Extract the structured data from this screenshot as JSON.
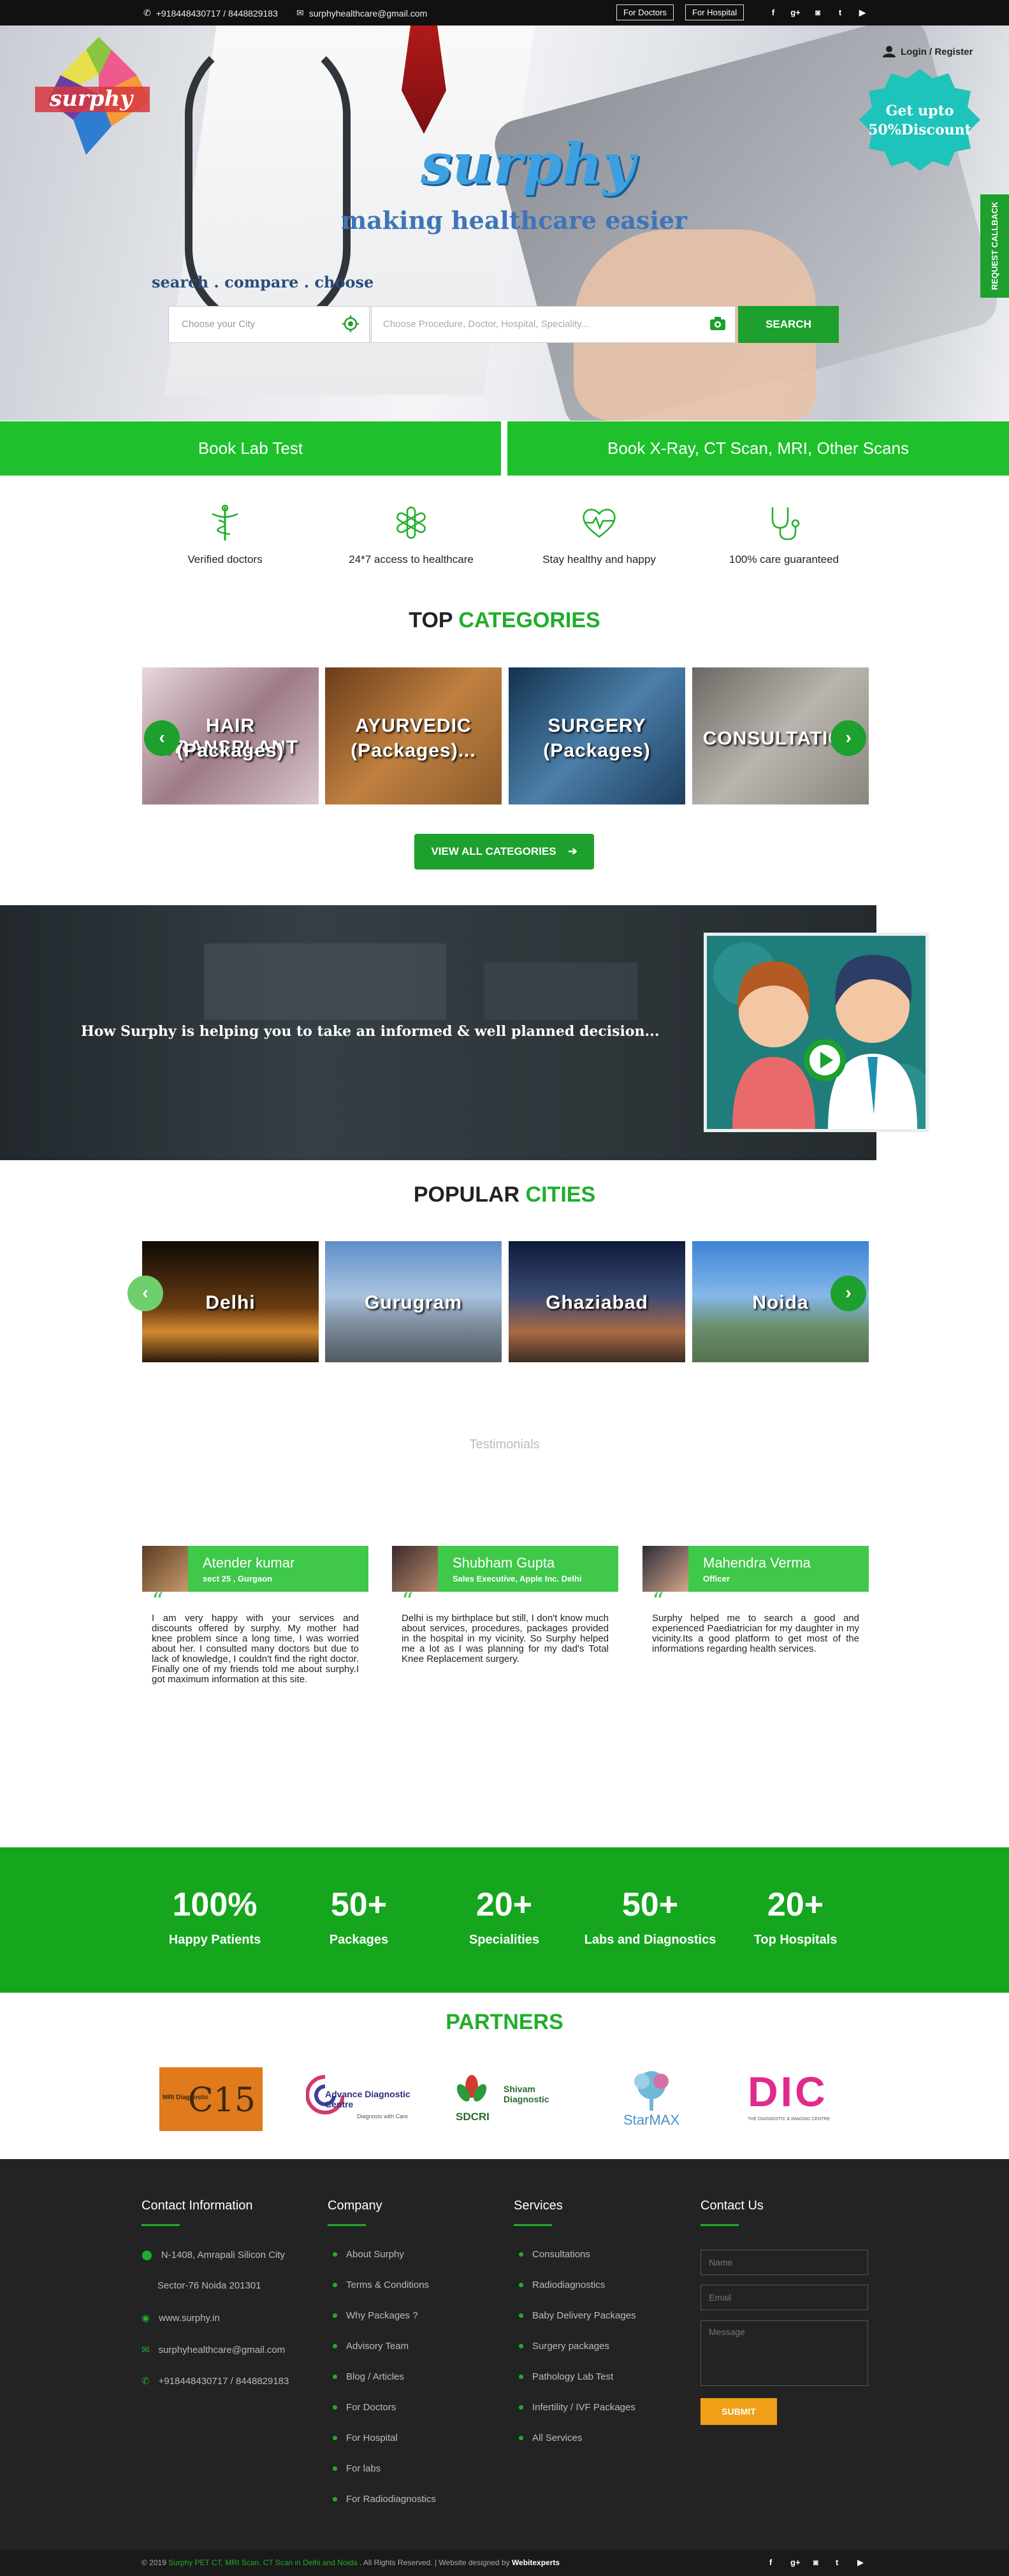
{
  "topbar": {
    "phone": "+918448430717 / 8448829183",
    "email": "surphyhealthcare@gmail.com",
    "btn_doctors": "For Doctors",
    "btn_hospital": "For Hospital",
    "social": [
      "facebook-icon",
      "google-plus-icon",
      "instagram-icon",
      "twitter-icon",
      "youtube-icon"
    ]
  },
  "hero": {
    "logo": "surphy",
    "brand": "surphy",
    "tagline": "making healthcare easier",
    "scc": "search . compare . choose",
    "city_placeholder": "Choose your City",
    "procedure_placeholder": "Choose Procedure, Doctor, Hospital, Speciality...",
    "search_label": "SEARCH",
    "login_label": "Login / Register",
    "badge_line1": "Get upto",
    "badge_line2": "50%Discount",
    "callback_label": "REQUEST CALLBACK"
  },
  "book": {
    "lab": "Book Lab Test",
    "scan": "Book X-Ray, CT Scan, MRI, Other Scans"
  },
  "features": [
    {
      "label": "Verified doctors",
      "icon": "caduceus-icon"
    },
    {
      "label": "24*7 access to healthcare",
      "icon": "medical-cross-icon"
    },
    {
      "label": "Stay healthy and happy",
      "icon": "heartbeat-icon"
    },
    {
      "label": "100% care guaranteed",
      "icon": "stethoscope-icon"
    }
  ],
  "categories": {
    "title_a": "TOP ",
    "title_b": "CATEGORIES",
    "items": [
      {
        "line1": "HAIR TRANSPLANT",
        "line2": "(Packages)"
      },
      {
        "line1": "AYURVEDIC",
        "line2": "(Packages)..."
      },
      {
        "line1": "SURGERY",
        "line2": "(Packages)"
      },
      {
        "line1": "CONSULTATION",
        "line2": ""
      }
    ],
    "view_all": "VIEW ALL CATEGORIES"
  },
  "video": {
    "text": "How Surphy is helping you to take an informed & well planned decision..."
  },
  "cities": {
    "title_a": "POPULAR ",
    "title_b": "CITIES",
    "items": [
      "Delhi",
      "Gurugram",
      "Ghaziabad",
      "Noida"
    ]
  },
  "testimonials": {
    "heading": "Testimonials",
    "items": [
      {
        "name": "Atender kumar",
        "sub": "sect 25 , Gurgaon",
        "text": "I am very happy with your services and discounts offered by surphy. My mother had knee problem since a long time, I was worried about her. I consulted many doctors but due to lack of knowledge, I couldn't find the right doctor. Finally one of my friends told me about surphy.I got maximum information at this site."
      },
      {
        "name": "Shubham Gupta",
        "sub": "Sales Executive, Apple Inc. Delhi",
        "text": "Delhi is my birthplace but still, I don't know much about services, procedures, packages provided in the hospital in my vicinity. So Surphy helped me a lot as I was planning for my dad's Total Knee Replacement surgery."
      },
      {
        "name": "Mahendra Verma",
        "sub": "Officer",
        "text": "Surphy helped me to search a good and experienced Paediatrician for my daughter in my vicinity.Its a good platform to get most of the informations regarding health services."
      }
    ]
  },
  "stats": [
    {
      "num": "100%",
      "label": "Happy Patients"
    },
    {
      "num": "50+",
      "label": "Packages"
    },
    {
      "num": "20+",
      "label": "Specialities"
    },
    {
      "num": "50+",
      "label": "Labs and Diagnostics"
    },
    {
      "num": "20+",
      "label": "Top Hospitals"
    }
  ],
  "partners": {
    "title": "PARTNERS",
    "items": [
      {
        "name": "MRI Diagnostic",
        "code": "C15"
      },
      {
        "name": "Advance Diagnostic Centre",
        "sub": "Diagnosis with Care"
      },
      {
        "name": "Shivam Diagnostic",
        "code": "SDCRI"
      },
      {
        "name": "StarMAX"
      },
      {
        "name": "DIC",
        "sub": "THE DIAGNOSTIC & IMAGING CENTRE"
      }
    ]
  },
  "footer": {
    "contact_info_title": "Contact Information",
    "address1": "N-1408, Amrapali Silicon City",
    "address2": "Sector-76 Noida 201301",
    "website": "www.surphy.in",
    "email": "surphyhealthcare@gmail.com",
    "phone": "+918448430717 / 8448829183",
    "company_title": "Company",
    "company_links": [
      "About Surphy",
      "Terms & Conditions",
      "Why Packages ?",
      "Advisory Team",
      "Blog / Articles",
      "For Doctors",
      "For Hospital",
      "For labs",
      "For Radiodiagnostics"
    ],
    "services_title": "Services",
    "services_links": [
      "Consultations",
      "Radiodiagnostics",
      "Baby Delivery Packages",
      "Surgery packages",
      "Pathology Lab Test",
      "Infertility / IVF Packages",
      "All Services"
    ],
    "contact_title": "Contact Us",
    "name_placeholder": "Name",
    "email_placeholder": "Email",
    "message_placeholder": "Message",
    "submit": "SUBMIT",
    "copy_pre": "© 2019 ",
    "copy_green": "Surphy PET CT, MRI Scan, CT Scan in Delhi and Noida",
    "copy_mid": " . All Rights Reserved. | Website designed by ",
    "copy_bold": "Webitexperts"
  },
  "colors": {
    "brand_green": "#1da02d",
    "bright_green": "#1ec12c",
    "footer_bg": "#232323",
    "badge_teal": "#1ec3bb"
  }
}
